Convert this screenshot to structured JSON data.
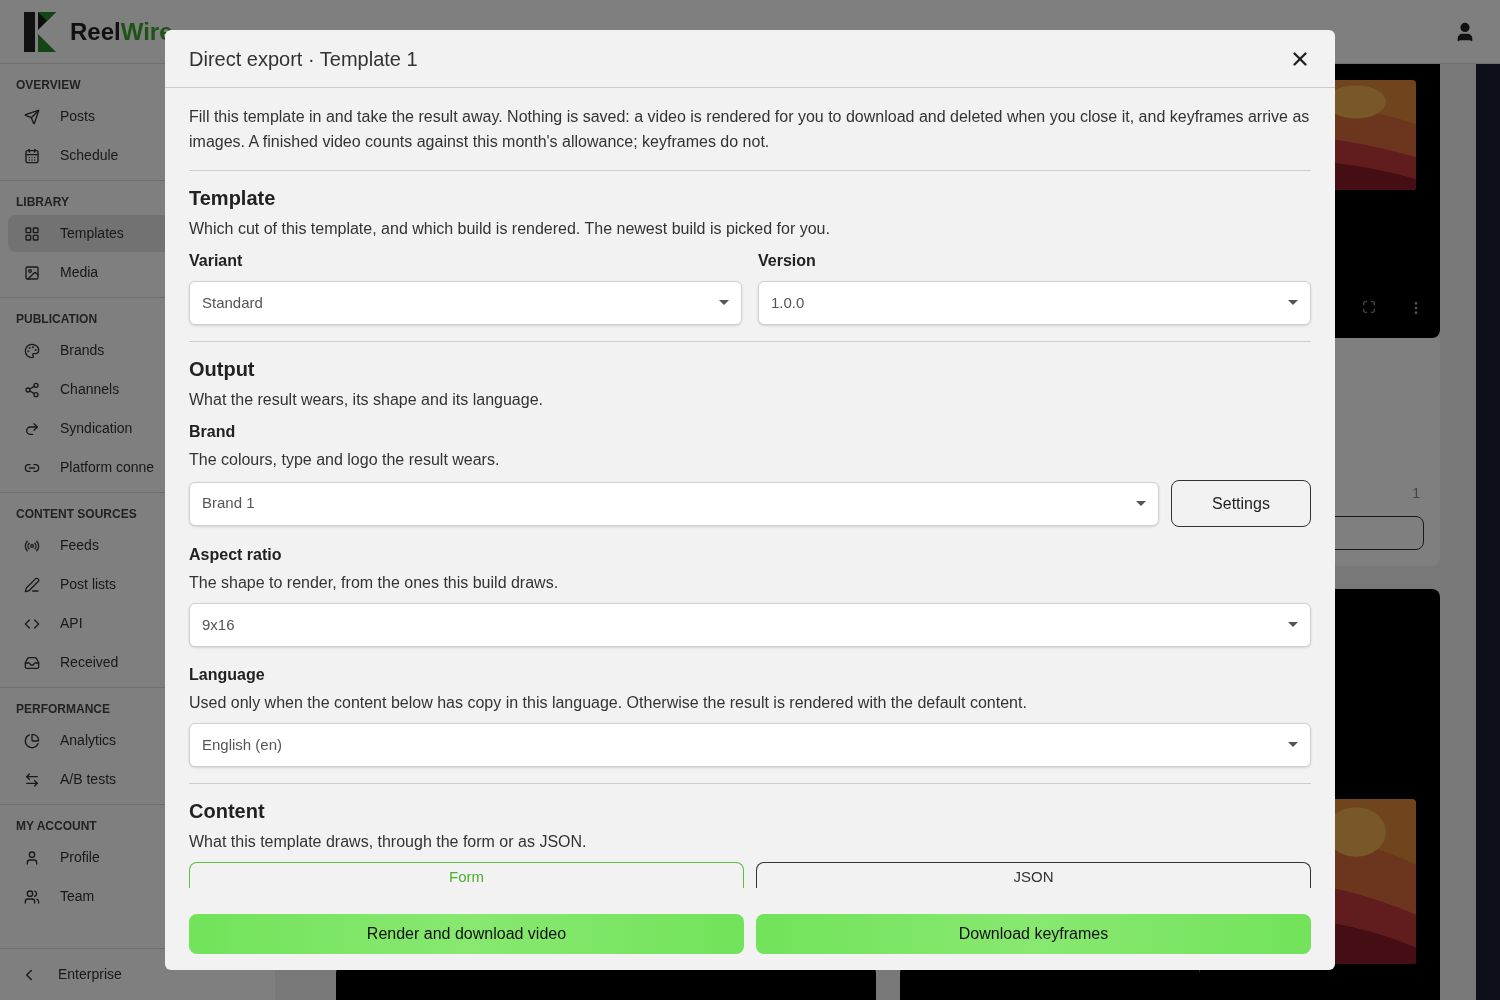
{
  "app": {
    "logo_part1": "Reel",
    "logo_part2": "Wire"
  },
  "sidebar": {
    "sections": [
      {
        "title": "OVERVIEW",
        "items": [
          {
            "label": "Posts",
            "selected": false
          },
          {
            "label": "Schedule",
            "selected": false
          }
        ]
      },
      {
        "title": "LIBRARY",
        "items": [
          {
            "label": "Templates",
            "selected": true
          },
          {
            "label": "Media",
            "selected": false
          }
        ]
      },
      {
        "title": "PUBLICATION",
        "items": [
          {
            "label": "Brands",
            "selected": false
          },
          {
            "label": "Channels",
            "selected": false
          },
          {
            "label": "Syndication",
            "selected": false
          },
          {
            "label": "Platform conne",
            "selected": false
          }
        ]
      },
      {
        "title": "CONTENT SOURCES",
        "items": [
          {
            "label": "Feeds",
            "selected": false
          },
          {
            "label": "Post lists",
            "selected": false
          },
          {
            "label": "API",
            "selected": false
          },
          {
            "label": "Received",
            "selected": false
          }
        ]
      },
      {
        "title": "PERFORMANCE",
        "items": [
          {
            "label": "Analytics",
            "selected": false
          },
          {
            "label": "A/B tests",
            "selected": false
          }
        ]
      },
      {
        "title": "MY ACCOUNT",
        "items": [
          {
            "label": "Profile",
            "selected": false
          },
          {
            "label": "Team",
            "selected": false
          }
        ]
      }
    ],
    "footer": "Enterprise"
  },
  "background": {
    "count": "1"
  },
  "dialog": {
    "title": "Direct export · Template 1",
    "intro": "Fill this template in and take the result away. Nothing is saved: a video is rendered for you to download and deleted when you close it, and keyframes arrive as images. A finished video counts against this month's allowance; keyframes do not.",
    "template": {
      "heading": "Template",
      "description": "Which cut of this template, and which build is rendered. The newest build is picked for you.",
      "variant": {
        "label": "Variant",
        "value": "Standard"
      },
      "version": {
        "label": "Version",
        "value": "1.0.0"
      }
    },
    "output": {
      "heading": "Output",
      "description": "What the result wears, its shape and its language.",
      "brand": {
        "label": "Brand",
        "description": "The colours, type and logo the result wears.",
        "value": "Brand 1",
        "button": "Settings"
      },
      "aspect_ratio": {
        "label": "Aspect ratio",
        "description": "The shape to render, from the ones this build draws.",
        "value": "9x16"
      },
      "language": {
        "label": "Language",
        "description": "Used only when the content below has copy in this language. Otherwise the result is rendered with the default content.",
        "value": "English (en)"
      }
    },
    "content": {
      "heading": "Content",
      "description": "What this template draws, through the form or as JSON.",
      "tabs": [
        {
          "label": "Form",
          "selected": true
        },
        {
          "label": "JSON",
          "selected": false
        }
      ]
    },
    "actions": [
      "Render and download video",
      "Download keyframes"
    ]
  }
}
